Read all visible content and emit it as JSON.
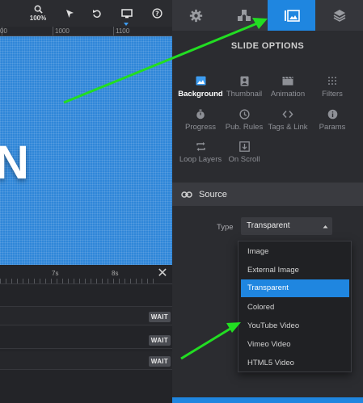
{
  "toolbar": {
    "zoom_label": "100%",
    "icons": [
      "zoom-icon",
      "pointer-icon",
      "undo-icon",
      "desktop-icon",
      "help-icon"
    ]
  },
  "ruler": {
    "labels": [
      "00",
      "1000",
      "1100"
    ]
  },
  "canvas": {
    "visible_text": "N",
    "background_color": "#2f86d8"
  },
  "timeline": {
    "marks": [
      "7s",
      "8s"
    ],
    "rows": [
      {
        "badge": "WAIT"
      },
      {
        "badge": "WAIT"
      },
      {
        "badge": "WAIT"
      }
    ]
  },
  "panel": {
    "tabs": [
      "settings-icon",
      "layers-puzzle-icon",
      "slide-options-icon",
      "stack-icon"
    ],
    "active_tab": 2,
    "title": "SLIDE OPTIONS",
    "options": [
      {
        "label": "Background",
        "icon": "image-icon",
        "active": true
      },
      {
        "label": "Thumbnail",
        "icon": "portrait-icon"
      },
      {
        "label": "Animation",
        "icon": "clapper-icon"
      },
      {
        "label": "Filters",
        "icon": "grid-dots-icon"
      },
      {
        "label": "Progress",
        "icon": "stopwatch-icon"
      },
      {
        "label": "Pub. Rules",
        "icon": "clock-icon"
      },
      {
        "label": "Tags & Link",
        "icon": "code-icon"
      },
      {
        "label": "Params",
        "icon": "info-icon"
      },
      {
        "label": "Loop Layers",
        "icon": "loop-icon"
      },
      {
        "label": "On Scroll",
        "icon": "scroll-down-icon"
      }
    ],
    "source": {
      "label": "Source",
      "icon": "link-icon"
    },
    "type_field": {
      "label": "Type",
      "value": "Transparent"
    },
    "dropdown": {
      "options": [
        "Image",
        "External Image",
        "Transparent",
        "Colored",
        "YouTube Video",
        "Vimeo Video",
        "HTML5 Video"
      ],
      "selected": "Transparent"
    }
  },
  "colors": {
    "accent": "#1f86e0",
    "annotation_arrow": "#22dd22",
    "panel_bg": "#2b2c30"
  }
}
